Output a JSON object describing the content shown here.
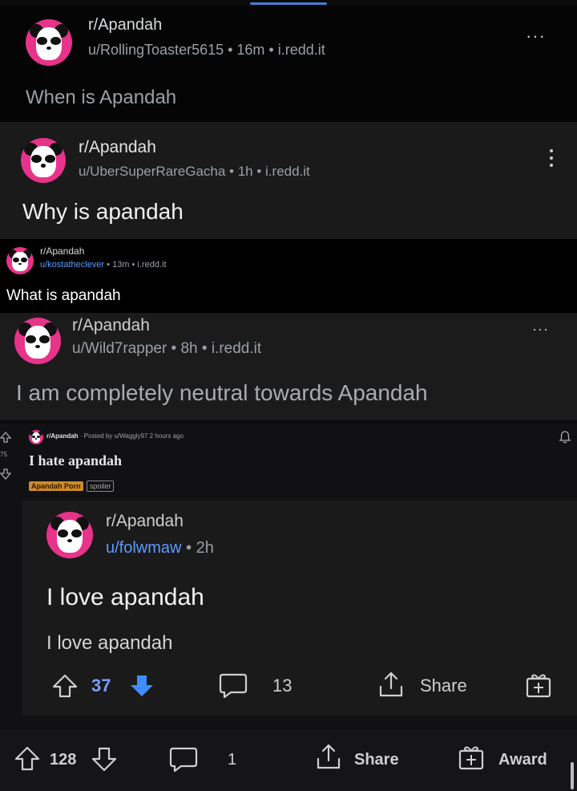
{
  "post1": {
    "subreddit": "r/Apandah",
    "meta": "u/RollingToaster5615 • 16m • i.redd.it",
    "title": "When is Apandah"
  },
  "post2": {
    "subreddit": "r/Apandah",
    "meta": "u/UberSuperRareGacha • 1h • i.redd.it",
    "title": "Why is apandah"
  },
  "post3": {
    "subreddit": "r/Apandah",
    "user": "u/kostatheclever",
    "meta": " • 13m • i.redd.it",
    "title": "What is apandah"
  },
  "post4": {
    "subreddit": "r/Apandah",
    "meta": "u/Wild7rapper • 8h • i.redd.it",
    "title": "I am completely neutral towards Apandah"
  },
  "post5": {
    "vote_count": "75",
    "subreddit": "r/Apandah",
    "meta": "· Posted by u/Waggly97 2 hours ago",
    "title": "I hate apandah",
    "flair": "Apandah Porn",
    "tag": "spoiler"
  },
  "post6": {
    "subreddit": "r/Apandah",
    "user": "u/folwmaw",
    "time": " • 2h",
    "title": "I love apandah",
    "body": "I love apandah",
    "upvotes": "37",
    "comments": "13",
    "share": "Share"
  },
  "footer": {
    "upvotes": "128",
    "comments": "1",
    "share": "Share",
    "award": "Award"
  },
  "colors": {
    "accent_blue": "#5b9cff",
    "avatar_pink": "#e8338a"
  }
}
